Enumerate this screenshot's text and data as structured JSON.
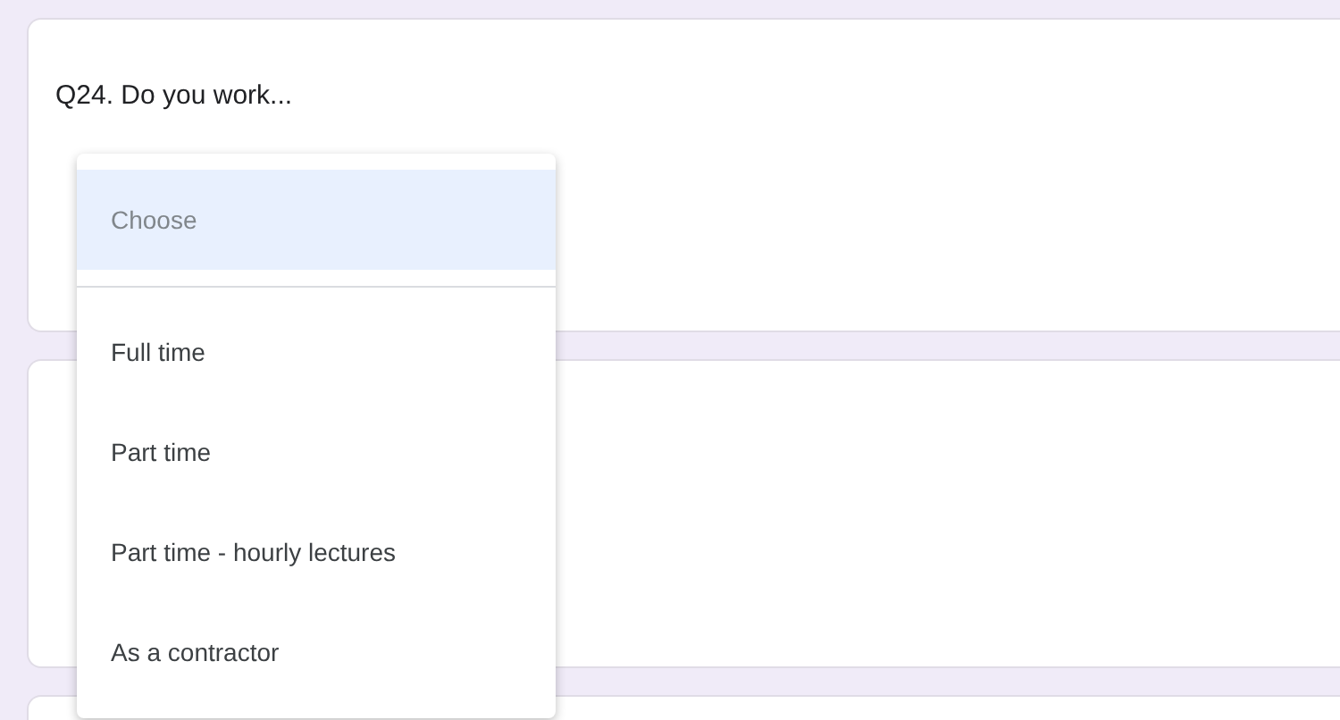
{
  "question": {
    "title": "Q24. Do you work..."
  },
  "dropdown": {
    "options": [
      {
        "label": "Choose",
        "kind": "placeholder",
        "selected": true
      },
      {
        "label": "Full time",
        "kind": "option",
        "selected": false
      },
      {
        "label": "Part time",
        "kind": "option",
        "selected": false
      },
      {
        "label": "Part time - hourly lectures",
        "kind": "option",
        "selected": false
      },
      {
        "label": "As a contractor",
        "kind": "option",
        "selected": false
      }
    ]
  }
}
